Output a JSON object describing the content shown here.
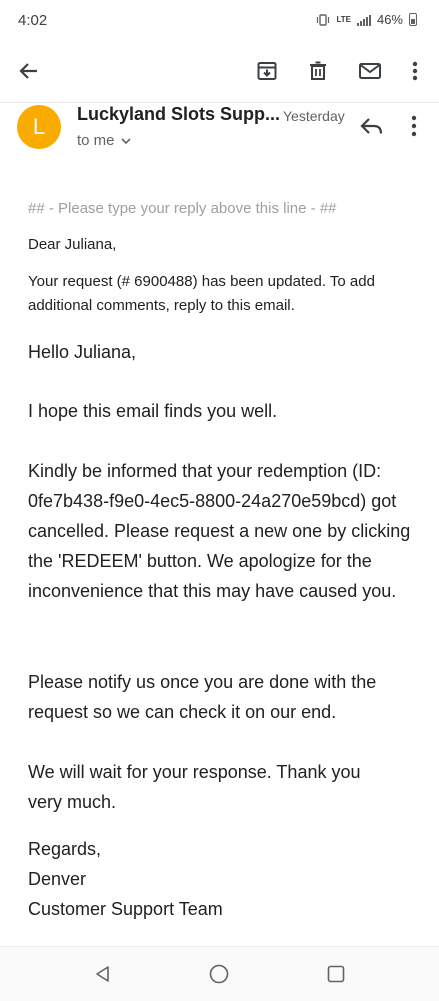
{
  "status_bar": {
    "time": "4:02",
    "network": "LTE",
    "battery": "46%"
  },
  "toolbar": {
    "icons": [
      "back-arrow-icon",
      "archive-icon",
      "delete-icon",
      "mail-icon",
      "more-vert-icon"
    ]
  },
  "email": {
    "avatar_letter": "L",
    "avatar_color": "#f9ab00",
    "sender": "Luckyland Slots Supp...",
    "date": "Yesterday",
    "recipient": "to me",
    "reply_line": "## - Please type your reply above this line - ##",
    "greeting_small": "Dear Juliana,",
    "update_notice": "Your request (# 6900488) has been updated. To add additional comments, reply to this email.",
    "greeting": "Hello Juliana,",
    "paragraph_1": "I hope this email finds you well.",
    "paragraph_2": "Kindly be informed that your redemption (ID: 0fe7b438-f9e0-4ec5-8800-24a270e59bcd) got cancelled.  Please request a new one by clicking the 'REDEEM' button.  We apologize for the inconvenience that this may have caused you.",
    "paragraph_3": "Please notify us once you are done with the request so we can check it on our end.",
    "paragraph_4": "We will wait for your response.  Thank you very much.",
    "signoff": "Regards,",
    "signer": "Denver",
    "team": "Customer Support Team"
  },
  "nav_bar": {
    "icons": [
      "back-triangle-icon",
      "home-circle-icon",
      "recents-square-icon"
    ]
  }
}
